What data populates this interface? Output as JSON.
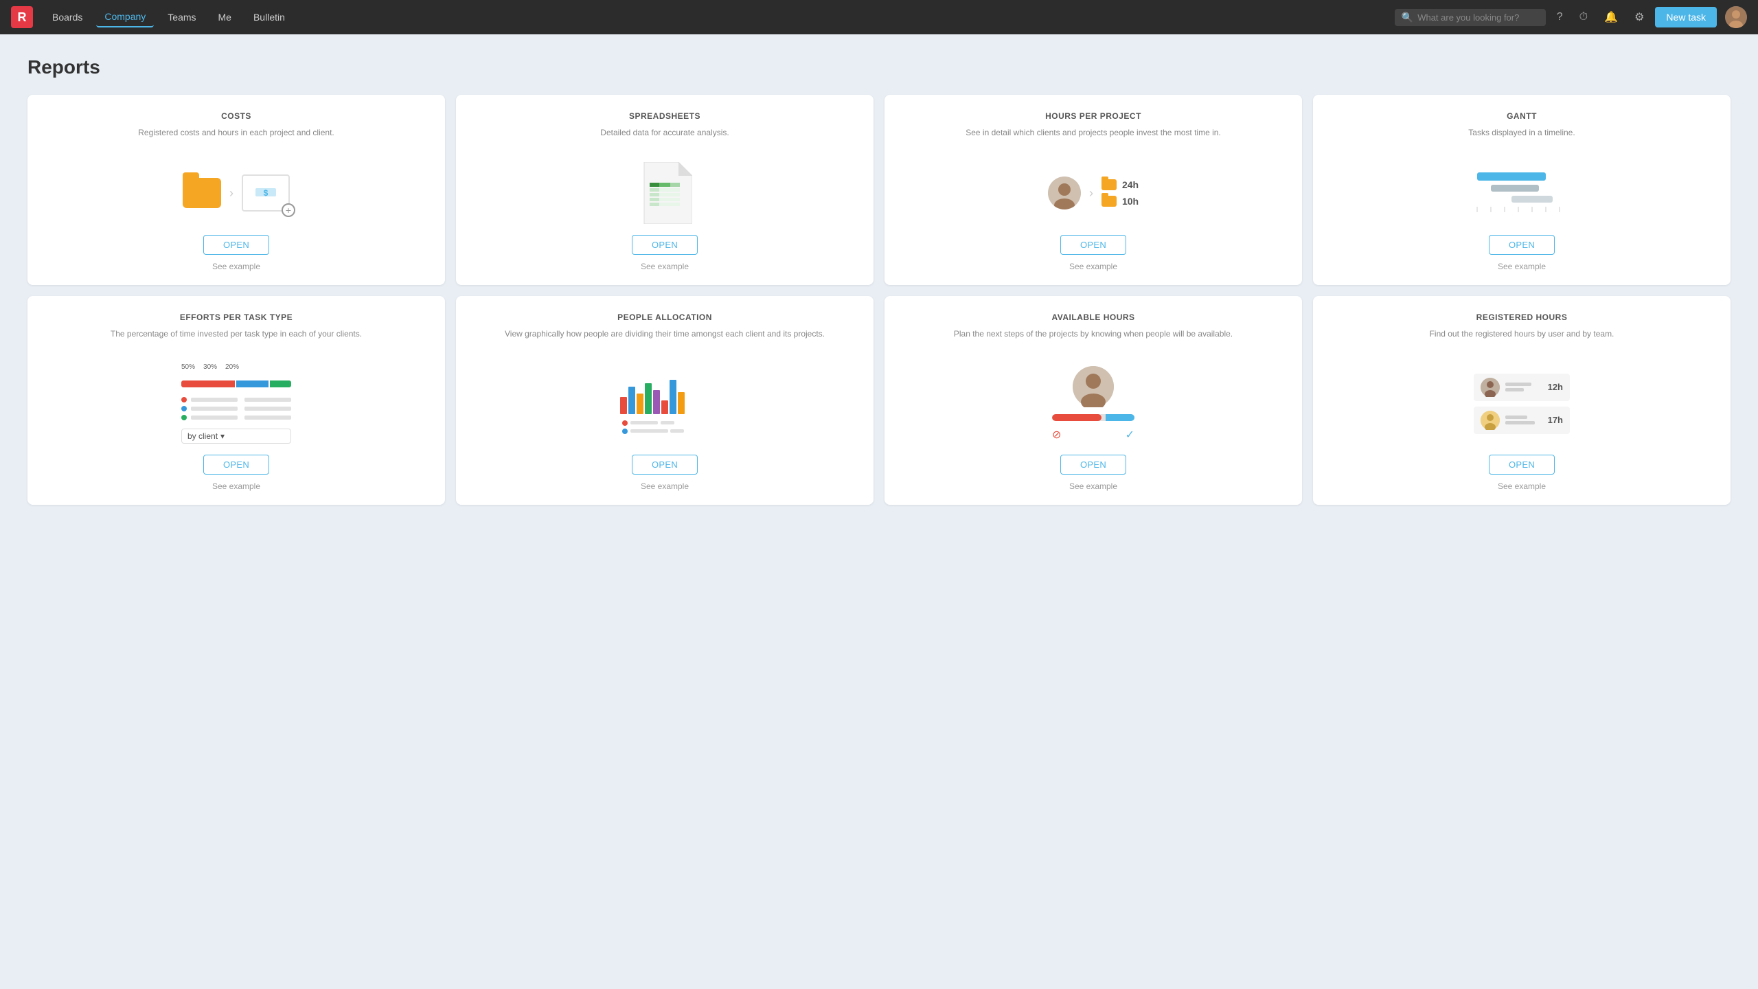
{
  "app": {
    "logo": "R",
    "logo_color": "#e63946"
  },
  "navbar": {
    "items": [
      {
        "id": "boards",
        "label": "Boards",
        "active": false
      },
      {
        "id": "company",
        "label": "Company",
        "active": true
      },
      {
        "id": "teams",
        "label": "Teams",
        "active": false
      },
      {
        "id": "me",
        "label": "Me",
        "active": false
      },
      {
        "id": "bulletin",
        "label": "Bulletin",
        "active": false
      }
    ],
    "search_placeholder": "What are you looking for?",
    "new_task_label": "New task"
  },
  "page": {
    "title": "Reports"
  },
  "reports": [
    {
      "id": "costs",
      "title": "COSTS",
      "description": "Registered costs and hours in each project and client.",
      "open_label": "OPEN",
      "see_example_label": "See example"
    },
    {
      "id": "spreadsheets",
      "title": "SPREADSHEETS",
      "description": "Detailed data for accurate analysis.",
      "open_label": "OPEN",
      "see_example_label": "See example"
    },
    {
      "id": "hours-per-project",
      "title": "HOURS PER PROJECT",
      "description": "See in detail which clients and projects people invest the most time in.",
      "open_label": "OPEN",
      "see_example_label": "See example",
      "hours": [
        "24h",
        "10h"
      ]
    },
    {
      "id": "gantt",
      "title": "GANTT",
      "description": "Tasks displayed in a timeline.",
      "open_label": "OPEN",
      "see_example_label": "See example"
    },
    {
      "id": "efforts-per-task",
      "title": "EFFORTS PER TASK TYPE",
      "description": "The percentage of time invested per task type in each of your clients.",
      "open_label": "OPEN",
      "see_example_label": "See example",
      "by_client_label": "by client",
      "percentages": [
        "50%",
        "30%",
        "20%"
      ]
    },
    {
      "id": "people-allocation",
      "title": "PEOPLE ALLOCATION",
      "description": "View graphically how people are dividing their time amongst each client and its projects.",
      "open_label": "OPEN",
      "see_example_label": "See example"
    },
    {
      "id": "available-hours",
      "title": "AVAILABLE HOURS",
      "description": "Plan the next steps of the projects by knowing when people will be available.",
      "open_label": "OPEN",
      "see_example_label": "See example"
    },
    {
      "id": "registered-hours",
      "title": "REGISTERED HOURS",
      "description": "Find out the registered hours by user and by team.",
      "open_label": "OPEN",
      "see_example_label": "See example",
      "hours": [
        "12h",
        "17h"
      ]
    }
  ]
}
